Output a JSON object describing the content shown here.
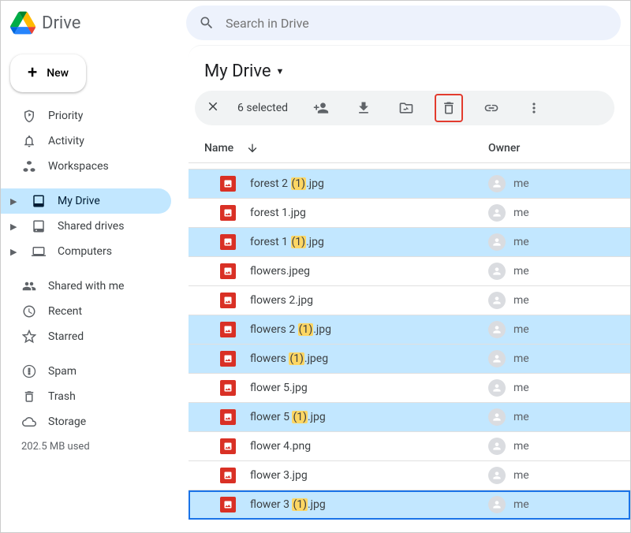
{
  "brand": "Drive",
  "search": {
    "placeholder": "Search in Drive"
  },
  "new_button": "New",
  "sidebar": {
    "top": [
      {
        "label": "Priority"
      },
      {
        "label": "Activity"
      },
      {
        "label": "Workspaces"
      }
    ],
    "mid": [
      {
        "label": "My Drive",
        "active": true
      },
      {
        "label": "Shared drives"
      },
      {
        "label": "Computers"
      }
    ],
    "bottom": [
      {
        "label": "Shared with me"
      },
      {
        "label": "Recent"
      },
      {
        "label": "Starred"
      }
    ],
    "footer": [
      {
        "label": "Spam"
      },
      {
        "label": "Trash"
      },
      {
        "label": "Storage"
      }
    ],
    "storage_used": "202.5 MB used"
  },
  "title": "My Drive",
  "selection_count": "6 selected",
  "columns": {
    "name": "Name",
    "owner": "Owner"
  },
  "owner_me": "me",
  "files": [
    {
      "name_pre": "forest 2 ",
      "name_hl": "(1)",
      "name_post": ".jpg",
      "selected": true
    },
    {
      "name_pre": "forest 1.jpg",
      "name_hl": "",
      "name_post": "",
      "selected": false
    },
    {
      "name_pre": "forest 1 ",
      "name_hl": "(1)",
      "name_post": ".jpg",
      "selected": true
    },
    {
      "name_pre": "flowers.jpeg",
      "name_hl": "",
      "name_post": "",
      "selected": false
    },
    {
      "name_pre": "flowers 2.jpg",
      "name_hl": "",
      "name_post": "",
      "selected": false
    },
    {
      "name_pre": "flowers 2 ",
      "name_hl": "(1)",
      "name_post": ".jpg",
      "selected": true
    },
    {
      "name_pre": "flowers ",
      "name_hl": "(1)",
      "name_post": ".jpeg",
      "selected": true
    },
    {
      "name_pre": "flower 5.jpg",
      "name_hl": "",
      "name_post": "",
      "selected": false
    },
    {
      "name_pre": "flower 5 ",
      "name_hl": "(1)",
      "name_post": ".jpg",
      "selected": true
    },
    {
      "name_pre": "flower 4.png",
      "name_hl": "",
      "name_post": "",
      "selected": false
    },
    {
      "name_pre": "flower 3.jpg",
      "name_hl": "",
      "name_post": "",
      "selected": false
    },
    {
      "name_pre": "flower 3 ",
      "name_hl": "(1)",
      "name_post": ".jpg",
      "selected": true,
      "focused": true
    }
  ]
}
